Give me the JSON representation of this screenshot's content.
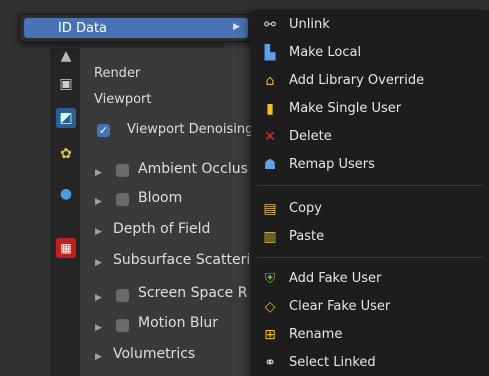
{
  "id_menu": {
    "label": "ID Data"
  },
  "panel": {
    "render_label": "Render",
    "viewport_label": "Viewport",
    "denoising_label": "Viewport Denoising",
    "rows": [
      {
        "label": "Ambient Occlus",
        "checkbox": true
      },
      {
        "label": "Bloom",
        "checkbox": true
      },
      {
        "label": "Depth of Field",
        "checkbox": false
      },
      {
        "label": "Subsurface Scatterin",
        "checkbox": false
      },
      {
        "label": "Screen Space R",
        "checkbox": true
      },
      {
        "label": "Motion Blur",
        "checkbox": true
      },
      {
        "label": "Volumetrics",
        "checkbox": false
      }
    ]
  },
  "submenu": {
    "unlink": "Unlink",
    "make_local": "Make Local",
    "add_library_override": "Add Library Override",
    "make_single_user": "Make Single User",
    "delete": "Delete",
    "remap_users": "Remap Users",
    "copy": "Copy",
    "paste": "Paste",
    "add_fake_user": "Add Fake User",
    "clear_fake_user": "Clear Fake User",
    "rename": "Rename",
    "select_linked": "Select Linked"
  },
  "icons": {
    "unlink": "broken-link-icon",
    "make_local": "make-local-icon",
    "library_override": "library-override-icon",
    "single_user": "single-user-icon",
    "delete": "x-icon",
    "remap": "users-icon",
    "copy": "clipboard-copy-icon",
    "paste": "clipboard-paste-icon",
    "fake_user": "shield-f-icon",
    "clear_fake": "shield-outline-icon",
    "rename": "rename-icon",
    "select_linked": "link-icon"
  },
  "colors": {
    "accent": "#4772b3",
    "menu_bg": "#1d1d1d",
    "delete_red": "#e03030"
  }
}
